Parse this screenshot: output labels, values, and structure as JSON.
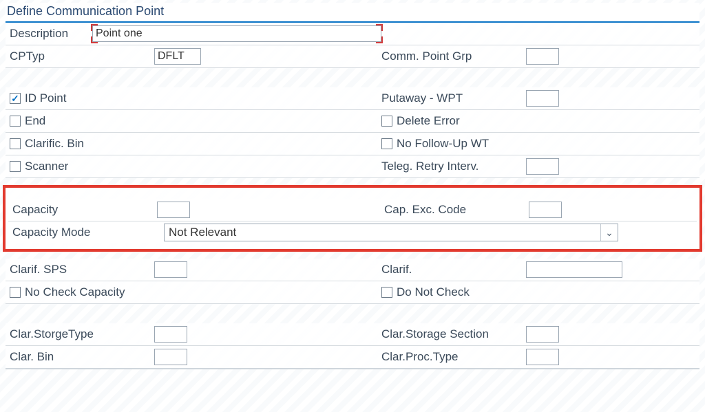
{
  "panel": {
    "title": "Define Communication Point"
  },
  "description": {
    "label": "Description",
    "value": "Point one"
  },
  "cptyp": {
    "label": "CPTyp",
    "value": "DFLT"
  },
  "comm_point_grp": {
    "label": "Comm. Point Grp",
    "value": ""
  },
  "checkboxes": {
    "id_point": {
      "label": "ID Point",
      "checked": true
    },
    "end": {
      "label": "End",
      "checked": false
    },
    "clarific_bin": {
      "label": "Clarific. Bin",
      "checked": false
    },
    "scanner": {
      "label": "Scanner",
      "checked": false
    },
    "delete_error": {
      "label": "Delete Error",
      "checked": false
    },
    "no_followup_wt": {
      "label": "No Follow-Up WT",
      "checked": false
    },
    "no_check_cap": {
      "label": "No Check Capacity",
      "checked": false
    },
    "do_not_check": {
      "label": "Do Not Check",
      "checked": false
    }
  },
  "putaway_wpt": {
    "label": "Putaway - WPT",
    "value": ""
  },
  "teleg_retry": {
    "label": "Teleg. Retry Interv.",
    "value": ""
  },
  "capacity": {
    "label": "Capacity",
    "value": ""
  },
  "cap_exc": {
    "label": "Cap. Exc. Code",
    "value": ""
  },
  "capacity_mode": {
    "label": "Capacity Mode",
    "value": "Not Relevant"
  },
  "clarif_sps": {
    "label": "Clarif. SPS",
    "value": ""
  },
  "clarif": {
    "label": "Clarif.",
    "value": ""
  },
  "clar_storage_type": {
    "label": "Clar.StorgeType",
    "value": ""
  },
  "clar_storage_section": {
    "label": "Clar.Storage Section",
    "value": ""
  },
  "clar_bin": {
    "label": "Clar. Bin",
    "value": ""
  },
  "clar_proc_type": {
    "label": "Clar.Proc.Type",
    "value": ""
  }
}
